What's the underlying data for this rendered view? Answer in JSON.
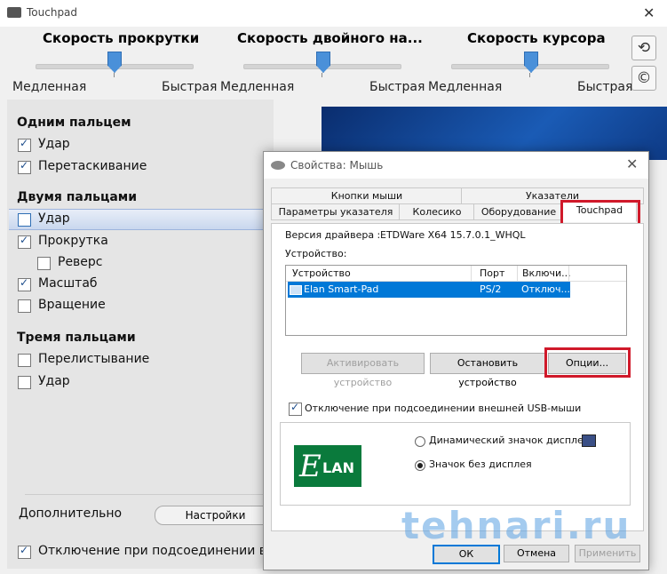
{
  "touchpad_window": {
    "title": "Touchpad",
    "sliders": [
      {
        "label": "Скорость прокрутки",
        "min_label": "Медленная",
        "max_label": "Быстрая",
        "value": 0.5
      },
      {
        "label": "Скорость двойного на...",
        "min_label": "Медленная",
        "max_label": "Быстрая",
        "value": 0.5
      },
      {
        "label": "Скорость курсора",
        "min_label": "Медленная",
        "max_label": "Быстрая",
        "value": 0.5
      }
    ],
    "sections": {
      "one_finger": {
        "title": "Одним пальцем",
        "tap": "Удар",
        "drag": "Перетаскивание"
      },
      "two_fingers": {
        "title": "Двумя пальцами",
        "tap": "Удар",
        "scroll": "Прокрутка",
        "reverse": "Реверс",
        "zoom": "Масштаб",
        "rotate": "Вращение"
      },
      "three_fingers": {
        "title": "Тремя пальцами",
        "flip": "Перелистывание",
        "tap": "Удар"
      }
    },
    "additional_label": "Дополнительно",
    "settings_button": "Настройки",
    "bottom_checkbox": "Отключение при подсоединении вне"
  },
  "dialog": {
    "title": "Свойства: Мышь",
    "tabs_row1": [
      "Кнопки мыши",
      "Указатели"
    ],
    "tabs_row2": [
      "Параметры указателя",
      "Колесико",
      "Оборудование",
      "Touchpad"
    ],
    "driver_label": "Версия драйвера :",
    "driver_value": "ETDWare X64 15.7.0.1_WHQL",
    "devices_label": "Устройство:",
    "list_headers": [
      "Устройство",
      "Порт",
      "Включи..."
    ],
    "list_row": {
      "device": "Elan Smart-Pad",
      "port": "PS/2",
      "state": "Отключ..."
    },
    "buttons": {
      "activate": "Активировать устройство",
      "stop": "Остановить устройство",
      "options": "Опции..."
    },
    "usb_checkbox": "Отключение при подсоединении внешней USB-мыши",
    "radio_dynamic": "Динамический значок дисплея",
    "radio_static": "Значок без дисплея",
    "logo_text": "LAN",
    "logo_letter": "E",
    "ok": "ОК",
    "cancel": "Отмена",
    "apply": "Применить"
  },
  "watermark": "tehnari.ru",
  "icons": [
    "reset-icon",
    "copyright-icon",
    "close-icon",
    "checkbox-checked-icon"
  ],
  "colors": {
    "accent": "#0078d7",
    "highlight_red": "#d0192a",
    "slider_thumb": "#4a90d9",
    "elan_green": "#0a7a3c"
  }
}
